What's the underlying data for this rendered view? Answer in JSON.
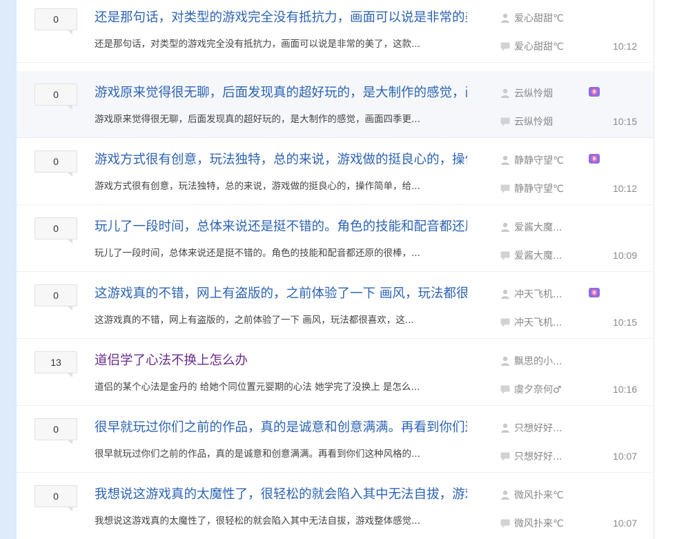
{
  "threads": [
    {
      "reply_count": "0",
      "title": "还是那句话，对类型的游戏完全没有抵抗力，画面可以说是非常的美",
      "abstract": "还是那句话，对类型的游戏完全没有抵抗力，画面可以说是非常的美了，这款...",
      "author": "爱心甜甜℃",
      "last_replier": "爱心甜甜℃",
      "time": "10:12",
      "badge": false,
      "visited": false,
      "highlighted": false
    },
    {
      "reply_count": "0",
      "title": "游戏原来觉得很无聊，后面发现真的超好玩的，是大制作的感觉，画",
      "abstract": "游戏原来觉得很无聊，后面发现真的超好玩的，是大制作的感觉，画面四季更...",
      "author": "云纵怜烟",
      "last_replier": "云纵怜烟",
      "time": "10:15",
      "badge": true,
      "visited": false,
      "highlighted": true
    },
    {
      "reply_count": "0",
      "title": "游戏方式很有创意，玩法独特，总的来说，游戏做的挺良心的，操作",
      "abstract": "游戏方式很有创意，玩法独特，总的来说，游戏做的挺良心的，操作简单，给...",
      "author": "静静守望℃",
      "last_replier": "静静守望℃",
      "time": "10:12",
      "badge": true,
      "visited": false,
      "highlighted": false
    },
    {
      "reply_count": "0",
      "title": "玩儿了一段时间，总体来说还是挺不错的。角色的技能和配音都还原",
      "abstract": "玩儿了一段时间，总体来说还是挺不错的。角色的技能和配音都还原的很棒，...",
      "author": "爱酱大魔...",
      "last_replier": "爱酱大魔...",
      "time": "10:09",
      "badge": false,
      "visited": false,
      "highlighted": false
    },
    {
      "reply_count": "0",
      "title": "这游戏真的不错，网上有盗版的，之前体验了一下 画风，玩法都很",
      "abstract": "这游戏真的不错，网上有盗版的，之前体验了一下 画风，玩法都很喜欢，这...",
      "author": "冲天飞机...",
      "last_replier": "冲天飞机...",
      "time": "10:15",
      "badge": true,
      "visited": false,
      "highlighted": false
    },
    {
      "reply_count": "13",
      "title": "道侣学了心法不换上怎么办",
      "abstract": "道侣的某个心法是金丹的 给她个同位置元婴期的心法 她学完了没换上 是怎么...",
      "author": "飘思的小...",
      "last_replier": "虞夕奈何♂",
      "time": "10:16",
      "badge": false,
      "visited": true,
      "highlighted": false
    },
    {
      "reply_count": "0",
      "title": "很早就玩过你们之前的作品，真的是诚意和创意满满。再看到你们这",
      "abstract": "很早就玩过你们之前的作品，真的是诚意和创意满满。再看到你们这种风格的...",
      "author": "只想好好...",
      "last_replier": "只想好好...",
      "time": "10:07",
      "badge": false,
      "visited": false,
      "highlighted": false
    },
    {
      "reply_count": "0",
      "title": "我想说这游戏真的太魔性了，很轻松的就会陷入其中无法自拔，游戏",
      "abstract": "我想说这游戏真的太魔性了，很轻松的就会陷入其中无法自拔，游戏整体感觉...",
      "author": "微风扑来℃",
      "last_replier": "微风扑来℃",
      "time": "10:07",
      "badge": false,
      "visited": false,
      "highlighted": false
    }
  ],
  "icons": {
    "author": "user-icon",
    "last_reply": "comment-icon",
    "badge": "vip-gem-icon"
  },
  "colors": {
    "link": "#2d64b3",
    "visited_link": "#6a2a8c",
    "meta_text": "#888888",
    "sidebar": "#ddebfa"
  }
}
